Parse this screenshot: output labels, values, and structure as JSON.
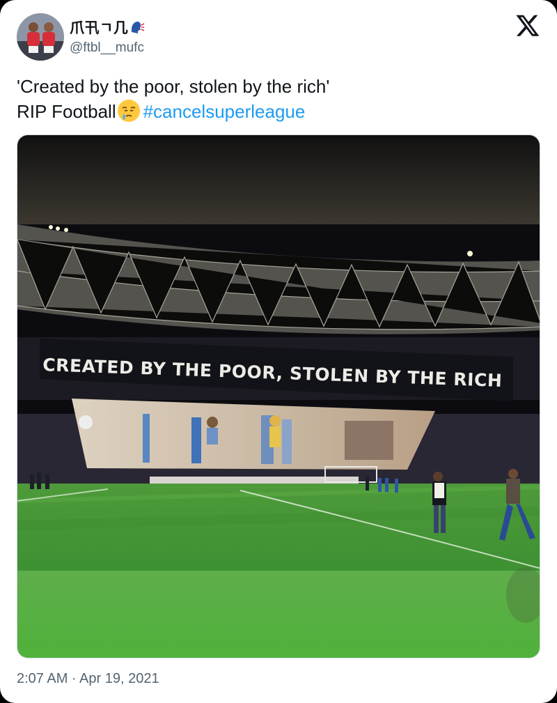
{
  "author": {
    "display_name": "爪卂ㄱ几",
    "display_emoji": "speaking-head-emoji",
    "handle": "@ftbl__mufc",
    "avatar_icon": "two-players-avatar"
  },
  "platform_icon": "x-logo-icon",
  "tweet": {
    "line1": "'Created by the poor, stolen by the rich'",
    "line2_prefix": "RIP Football",
    "line2_emoji": "sad-relieved-face-emoji",
    "hashtag": "#cancelsuperleague"
  },
  "media": {
    "banner_text": "CREATED BY THE POOR, STOLEN BY THE RICH",
    "description": "stadium tifo photo"
  },
  "timestamp": "2:07 AM · Apr 19, 2021",
  "colors": {
    "text": "#0f1419",
    "secondary": "#536471",
    "link": "#1d9bf0",
    "pitch": "#3f9a34"
  }
}
